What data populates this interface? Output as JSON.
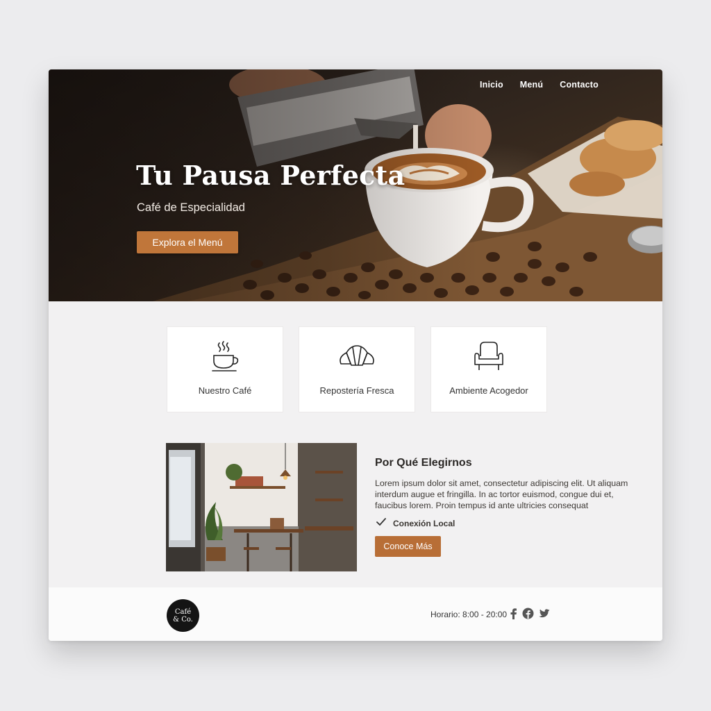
{
  "nav": {
    "items": [
      "Inicio",
      "Menú",
      "Contacto"
    ]
  },
  "hero": {
    "title": "Tu Pausa Perfecta",
    "subtitle": "Café de Especialidad",
    "cta": "Explora el Menú"
  },
  "features": [
    {
      "label": "Nuestro Café",
      "icon": "coffee-cup-icon"
    },
    {
      "label": "Repostería Fresca",
      "icon": "croissant-icon"
    },
    {
      "label": "Ambiente Acogedor",
      "icon": "armchair-icon"
    }
  ],
  "about": {
    "title": "Por Qué Elegirnos",
    "text": "Lorem ipsum dolor sit amet, consectetur adipiscing elit. Ut aliquam interdum augue et fringilla. In ac tortor euismod, congue dui et, faucibus lorem. Proin tempus id ante ultricies consequat",
    "check_label": "Conexión Local",
    "cta": "Conoce Más"
  },
  "footer": {
    "logo_line1": "Café",
    "logo_line2": "& Co.",
    "hours": "Horario: 8:00 - 20:00",
    "social": [
      "facebook-icon",
      "facebook-circle-icon",
      "twitter-icon"
    ]
  },
  "colors": {
    "accent": "#c0763a",
    "button_dark": "#b86e36",
    "page_bg": "#f2f1f2"
  }
}
